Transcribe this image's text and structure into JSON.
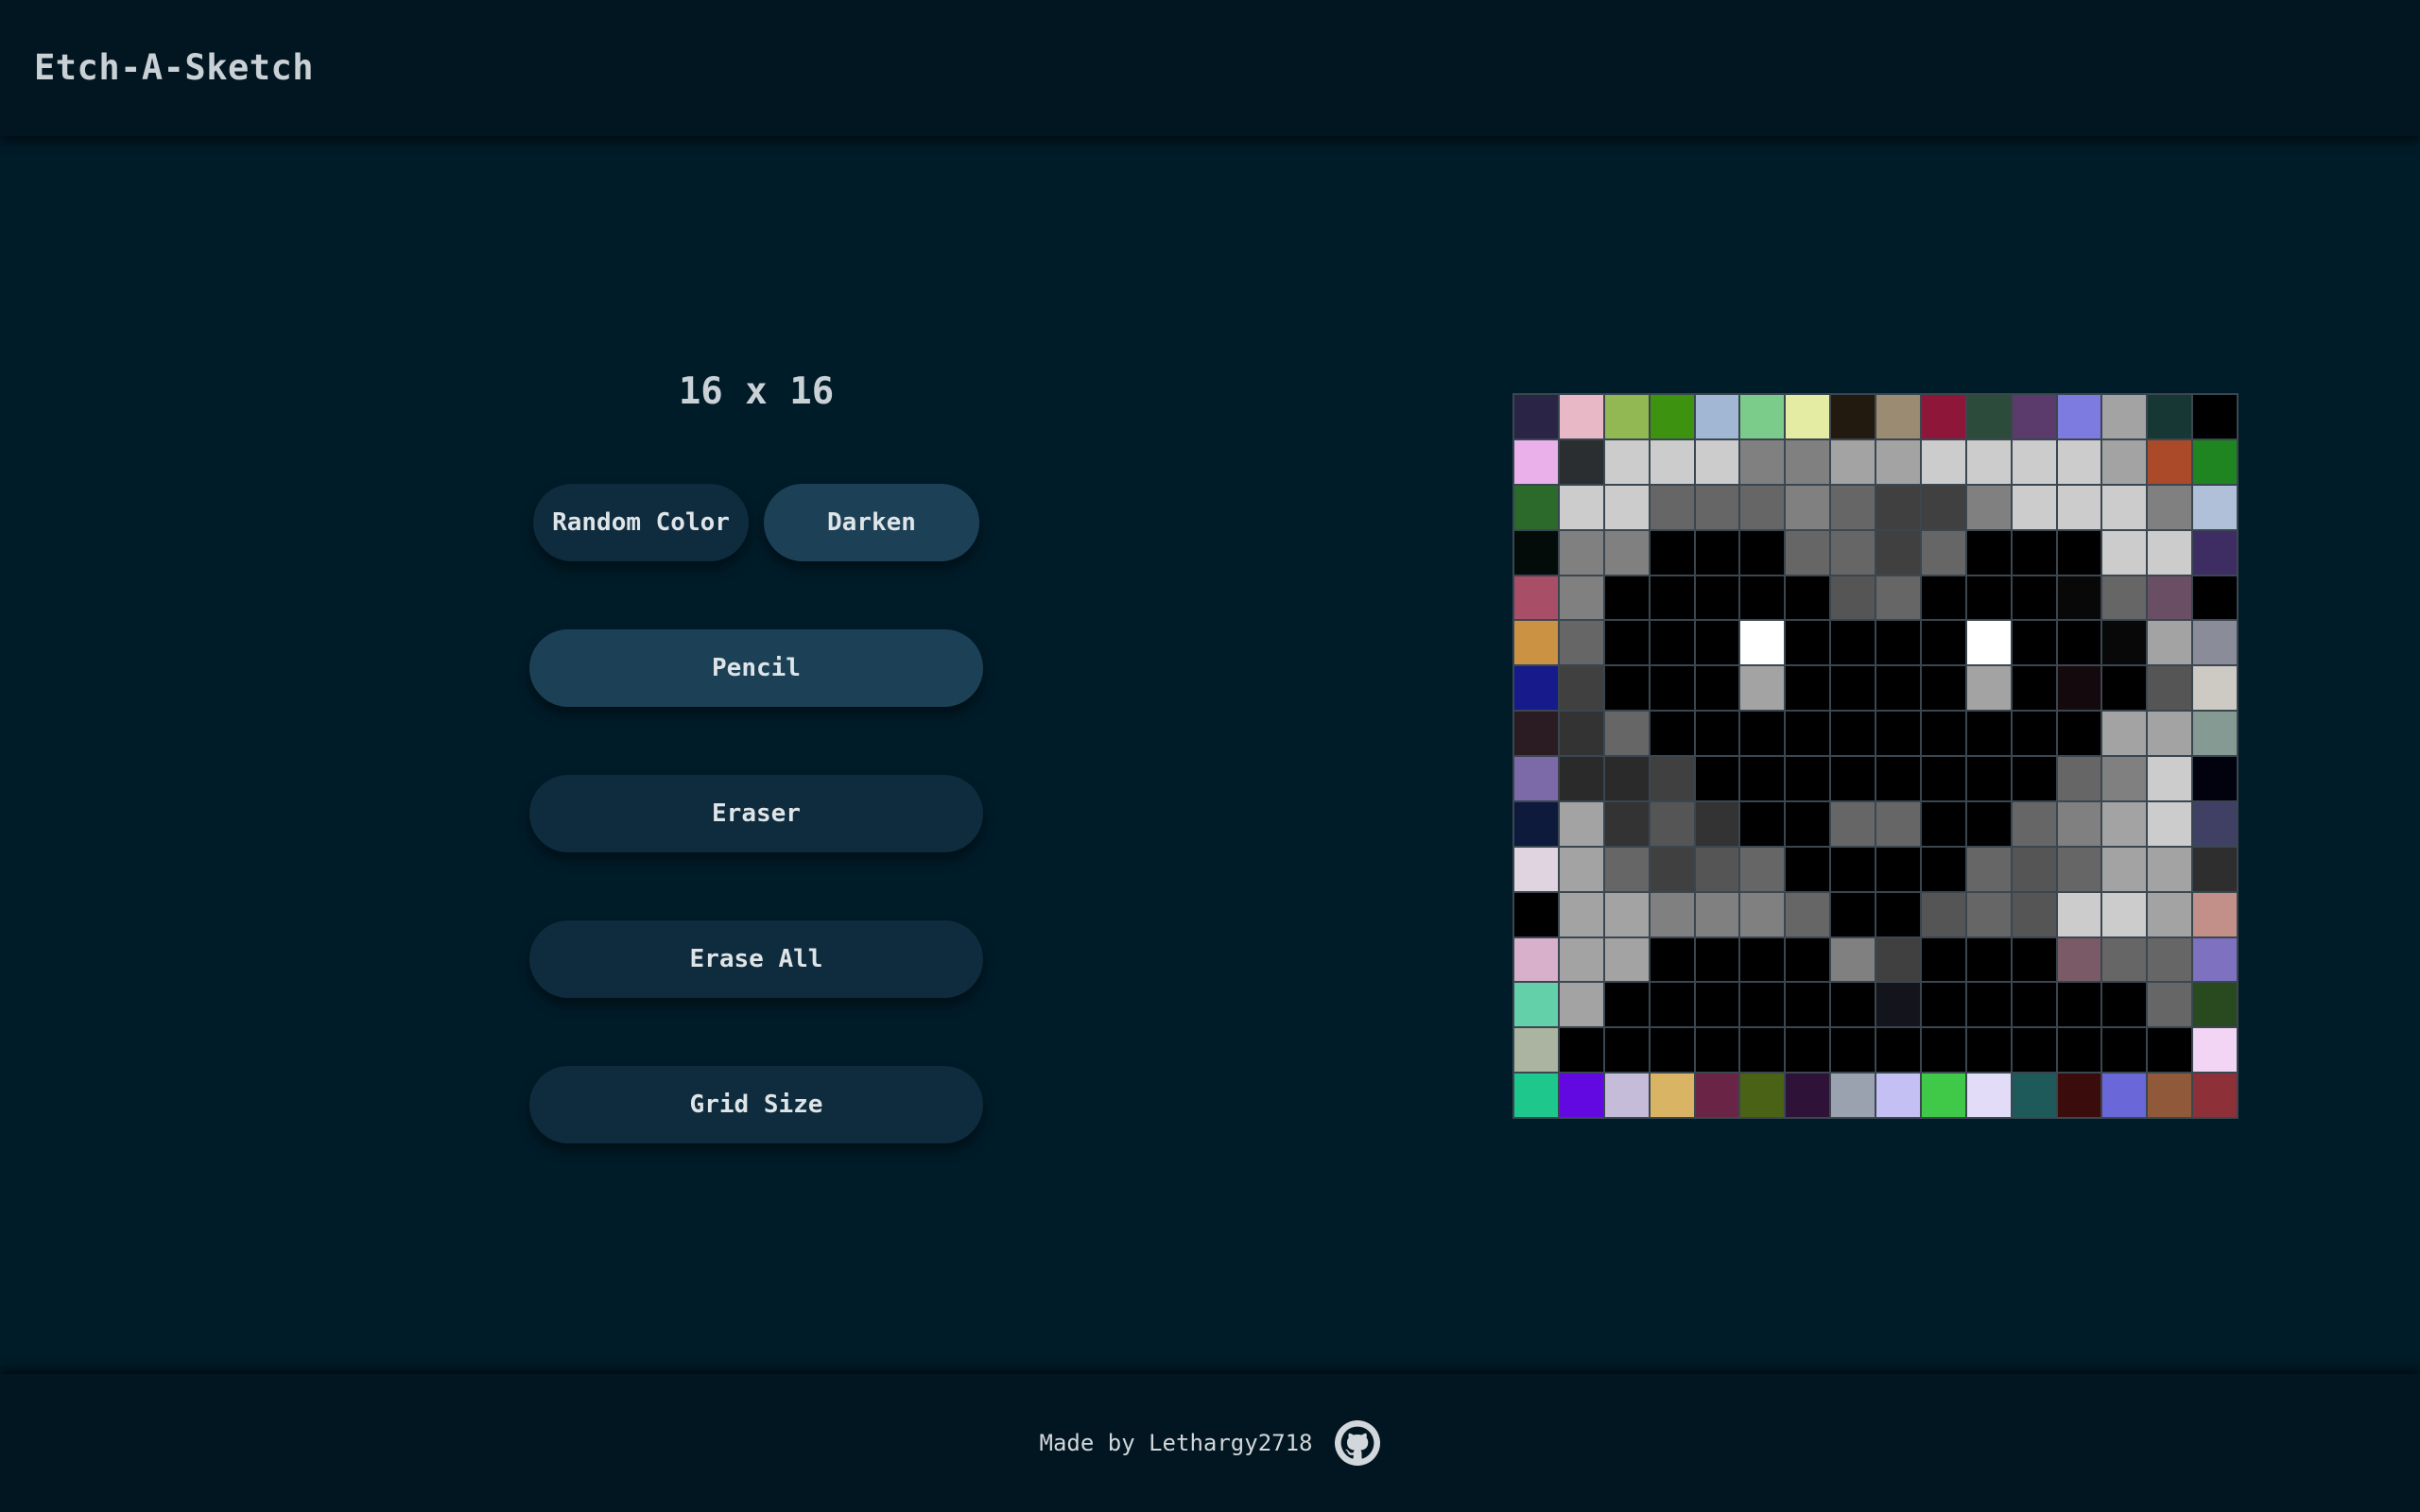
{
  "header": {
    "title": "Etch-A-Sketch"
  },
  "controls": {
    "grid_size_label": "16 x 16",
    "random_color_label": "Random Color",
    "darken_label": "Darken",
    "pencil_label": "Pencil",
    "eraser_label": "Eraser",
    "erase_all_label": "Erase All",
    "grid_size_button_label": "Grid Size",
    "active_tool": "Pencil"
  },
  "grid": {
    "rows": 16,
    "cols": 16,
    "border_color": "#3a4650",
    "cells": [
      [
        "#2a2446",
        "#e8b8c6",
        "#92b853",
        "#3d930f",
        "#a2b7d4",
        "#7bcc8a",
        "#e4eca4",
        "#221a0e",
        "#9b8b72",
        "#8e1638",
        "#2d4b3b",
        "#5a3b6b",
        "#7d7be0",
        "#a3a3a3",
        "#163734",
        "#000000"
      ],
      [
        "#eab0ea",
        "#2a2e30",
        "#cccccc",
        "#cccccc",
        "#cccccc",
        "#808080",
        "#808080",
        "#a3a3a3",
        "#a3a3a3",
        "#cccccc",
        "#cccccc",
        "#cccccc",
        "#cccccc",
        "#a3a3a3",
        "#aa4a28",
        "#1e8520"
      ],
      [
        "#2c6a2c",
        "#cccccc",
        "#cccccc",
        "#666666",
        "#666666",
        "#666666",
        "#808080",
        "#666666",
        "#404040",
        "#404040",
        "#808080",
        "#cccccc",
        "#cccccc",
        "#cccccc",
        "#808080",
        "#b0c0d8"
      ],
      [
        "#040c0a",
        "#808080",
        "#808080",
        "#000000",
        "#000000",
        "#000000",
        "#666666",
        "#666666",
        "#404040",
        "#666666",
        "#000000",
        "#000000",
        "#000000",
        "#cccccc",
        "#cccccc",
        "#3e2d62"
      ],
      [
        "#a84e66",
        "#808080",
        "#000000",
        "#000000",
        "#000000",
        "#000000",
        "#000000",
        "#555555",
        "#666666",
        "#000000",
        "#000000",
        "#000000",
        "#080808",
        "#666666",
        "#6a4e64"
      ],
      [
        "#cc9244",
        "#666666",
        "#000000",
        "#000000",
        "#000000",
        "#ffffff",
        "#000000",
        "#000000",
        "#000000",
        "#000000",
        "#ffffff",
        "#000000",
        "#000000",
        "#080808",
        "#a3a3a3",
        "#8a8c9a"
      ],
      [
        "#161a8a",
        "#404040",
        "#000000",
        "#000000",
        "#000000",
        "#a3a3a3",
        "#000000",
        "#000000",
        "#000000",
        "#000000",
        "#a3a3a3",
        "#000000",
        "#140a0e",
        "#000000",
        "#555555",
        "#cdcac4"
      ],
      [
        "#2a1c22",
        "#333333",
        "#666666",
        "#000000",
        "#000000",
        "#000000",
        "#000000",
        "#000000",
        "#000000",
        "#000000",
        "#000000",
        "#000000",
        "#000000",
        "#a3a3a3",
        "#a3a3a3",
        "#849a92"
      ],
      [
        "#7c6aa8",
        "#2a2a2a",
        "#2a2a2a",
        "#404040",
        "#000000",
        "#000000",
        "#000000",
        "#000000",
        "#000000",
        "#000000",
        "#000000",
        "#000000",
        "#666666",
        "#808080",
        "#cccccc",
        "#02020e"
      ],
      [
        "#0e1a3c",
        "#a3a3a3",
        "#333333",
        "#555555",
        "#333333",
        "#000000",
        "#000000",
        "#666666",
        "#666666",
        "#000000",
        "#000000",
        "#666666",
        "#808080",
        "#a3a3a3",
        "#cccccc",
        "#404064"
      ],
      [
        "#e0d4e0",
        "#a3a3a3",
        "#666666",
        "#404040",
        "#555555",
        "#666666",
        "#000000",
        "#000000",
        "#000000",
        "#000000",
        "#666666",
        "#555555",
        "#666666",
        "#a3a3a3",
        "#a3a3a3",
        "#2e2e2e"
      ],
      [
        "#000000",
        "#a3a3a3",
        "#a3a3a3",
        "#808080",
        "#808080",
        "#808080",
        "#666666",
        "#000000",
        "#000000",
        "#555555",
        "#666666",
        "#555555",
        "#cccccc",
        "#cccccc",
        "#a3a3a3",
        "#c29088"
      ],
      [
        "#d8b0cc",
        "#a3a3a3",
        "#a3a3a3",
        "#000000",
        "#000000",
        "#000000",
        "#000000",
        "#808080",
        "#404040",
        "#000000",
        "#000000",
        "#000000",
        "#7a5a66",
        "#666666",
        "#666666",
        "#7e72c0"
      ],
      [
        "#64d0aa",
        "#a3a3a3",
        "#000000",
        "#000000",
        "#000000",
        "#000000",
        "#000000",
        "#000000",
        "#14141c",
        "#000000",
        "#000000",
        "#000000",
        "#000000",
        "#000000",
        "#666666",
        "#284a1e"
      ],
      [
        "#aab4a0",
        "#000000",
        "#000000",
        "#000000",
        "#000000",
        "#000000",
        "#000000",
        "#000000",
        "#000000",
        "#000000",
        "#000000",
        "#000000",
        "#000000",
        "#000000",
        "#000000",
        "#f2d4f4"
      ],
      [
        "#1ec88c",
        "#6208e0",
        "#c4bcd8",
        "#d8b464",
        "#6a2446",
        "#4a6216",
        "#2e1238",
        "#9aa2b0",
        "#c4c0f4",
        "#40c848",
        "#e2dcf8",
        "#1e5a5a",
        "#3a0c0c",
        "#6a68d8",
        "#905a3a",
        "#8e3038"
      ]
    ]
  },
  "footer": {
    "text": "Made by Lethargy2718",
    "icon": "github-icon"
  }
}
